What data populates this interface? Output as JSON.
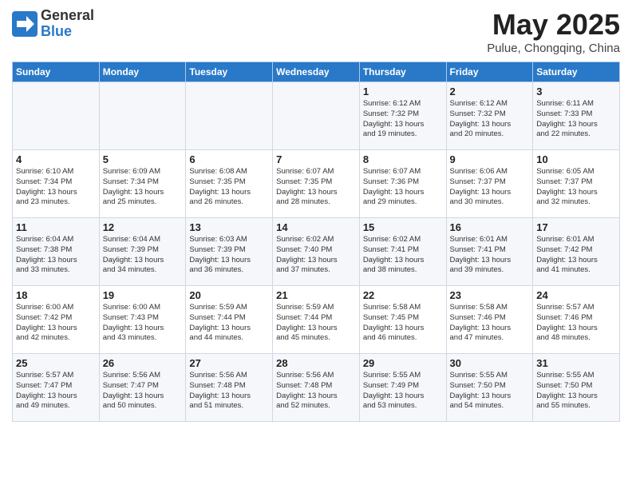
{
  "header": {
    "logo_general": "General",
    "logo_blue": "Blue",
    "title": "May 2025",
    "subtitle": "Pulue, Chongqing, China"
  },
  "columns": [
    "Sunday",
    "Monday",
    "Tuesday",
    "Wednesday",
    "Thursday",
    "Friday",
    "Saturday"
  ],
  "weeks": [
    {
      "days": [
        {
          "num": "",
          "info": ""
        },
        {
          "num": "",
          "info": ""
        },
        {
          "num": "",
          "info": ""
        },
        {
          "num": "",
          "info": ""
        },
        {
          "num": "1",
          "info": "Sunrise: 6:12 AM\nSunset: 7:32 PM\nDaylight: 13 hours\nand 19 minutes."
        },
        {
          "num": "2",
          "info": "Sunrise: 6:12 AM\nSunset: 7:32 PM\nDaylight: 13 hours\nand 20 minutes."
        },
        {
          "num": "3",
          "info": "Sunrise: 6:11 AM\nSunset: 7:33 PM\nDaylight: 13 hours\nand 22 minutes."
        }
      ]
    },
    {
      "days": [
        {
          "num": "4",
          "info": "Sunrise: 6:10 AM\nSunset: 7:34 PM\nDaylight: 13 hours\nand 23 minutes."
        },
        {
          "num": "5",
          "info": "Sunrise: 6:09 AM\nSunset: 7:34 PM\nDaylight: 13 hours\nand 25 minutes."
        },
        {
          "num": "6",
          "info": "Sunrise: 6:08 AM\nSunset: 7:35 PM\nDaylight: 13 hours\nand 26 minutes."
        },
        {
          "num": "7",
          "info": "Sunrise: 6:07 AM\nSunset: 7:35 PM\nDaylight: 13 hours\nand 28 minutes."
        },
        {
          "num": "8",
          "info": "Sunrise: 6:07 AM\nSunset: 7:36 PM\nDaylight: 13 hours\nand 29 minutes."
        },
        {
          "num": "9",
          "info": "Sunrise: 6:06 AM\nSunset: 7:37 PM\nDaylight: 13 hours\nand 30 minutes."
        },
        {
          "num": "10",
          "info": "Sunrise: 6:05 AM\nSunset: 7:37 PM\nDaylight: 13 hours\nand 32 minutes."
        }
      ]
    },
    {
      "days": [
        {
          "num": "11",
          "info": "Sunrise: 6:04 AM\nSunset: 7:38 PM\nDaylight: 13 hours\nand 33 minutes."
        },
        {
          "num": "12",
          "info": "Sunrise: 6:04 AM\nSunset: 7:39 PM\nDaylight: 13 hours\nand 34 minutes."
        },
        {
          "num": "13",
          "info": "Sunrise: 6:03 AM\nSunset: 7:39 PM\nDaylight: 13 hours\nand 36 minutes."
        },
        {
          "num": "14",
          "info": "Sunrise: 6:02 AM\nSunset: 7:40 PM\nDaylight: 13 hours\nand 37 minutes."
        },
        {
          "num": "15",
          "info": "Sunrise: 6:02 AM\nSunset: 7:41 PM\nDaylight: 13 hours\nand 38 minutes."
        },
        {
          "num": "16",
          "info": "Sunrise: 6:01 AM\nSunset: 7:41 PM\nDaylight: 13 hours\nand 39 minutes."
        },
        {
          "num": "17",
          "info": "Sunrise: 6:01 AM\nSunset: 7:42 PM\nDaylight: 13 hours\nand 41 minutes."
        }
      ]
    },
    {
      "days": [
        {
          "num": "18",
          "info": "Sunrise: 6:00 AM\nSunset: 7:42 PM\nDaylight: 13 hours\nand 42 minutes."
        },
        {
          "num": "19",
          "info": "Sunrise: 6:00 AM\nSunset: 7:43 PM\nDaylight: 13 hours\nand 43 minutes."
        },
        {
          "num": "20",
          "info": "Sunrise: 5:59 AM\nSunset: 7:44 PM\nDaylight: 13 hours\nand 44 minutes."
        },
        {
          "num": "21",
          "info": "Sunrise: 5:59 AM\nSunset: 7:44 PM\nDaylight: 13 hours\nand 45 minutes."
        },
        {
          "num": "22",
          "info": "Sunrise: 5:58 AM\nSunset: 7:45 PM\nDaylight: 13 hours\nand 46 minutes."
        },
        {
          "num": "23",
          "info": "Sunrise: 5:58 AM\nSunset: 7:46 PM\nDaylight: 13 hours\nand 47 minutes."
        },
        {
          "num": "24",
          "info": "Sunrise: 5:57 AM\nSunset: 7:46 PM\nDaylight: 13 hours\nand 48 minutes."
        }
      ]
    },
    {
      "days": [
        {
          "num": "25",
          "info": "Sunrise: 5:57 AM\nSunset: 7:47 PM\nDaylight: 13 hours\nand 49 minutes."
        },
        {
          "num": "26",
          "info": "Sunrise: 5:56 AM\nSunset: 7:47 PM\nDaylight: 13 hours\nand 50 minutes."
        },
        {
          "num": "27",
          "info": "Sunrise: 5:56 AM\nSunset: 7:48 PM\nDaylight: 13 hours\nand 51 minutes."
        },
        {
          "num": "28",
          "info": "Sunrise: 5:56 AM\nSunset: 7:48 PM\nDaylight: 13 hours\nand 52 minutes."
        },
        {
          "num": "29",
          "info": "Sunrise: 5:55 AM\nSunset: 7:49 PM\nDaylight: 13 hours\nand 53 minutes."
        },
        {
          "num": "30",
          "info": "Sunrise: 5:55 AM\nSunset: 7:50 PM\nDaylight: 13 hours\nand 54 minutes."
        },
        {
          "num": "31",
          "info": "Sunrise: 5:55 AM\nSunset: 7:50 PM\nDaylight: 13 hours\nand 55 minutes."
        }
      ]
    }
  ]
}
